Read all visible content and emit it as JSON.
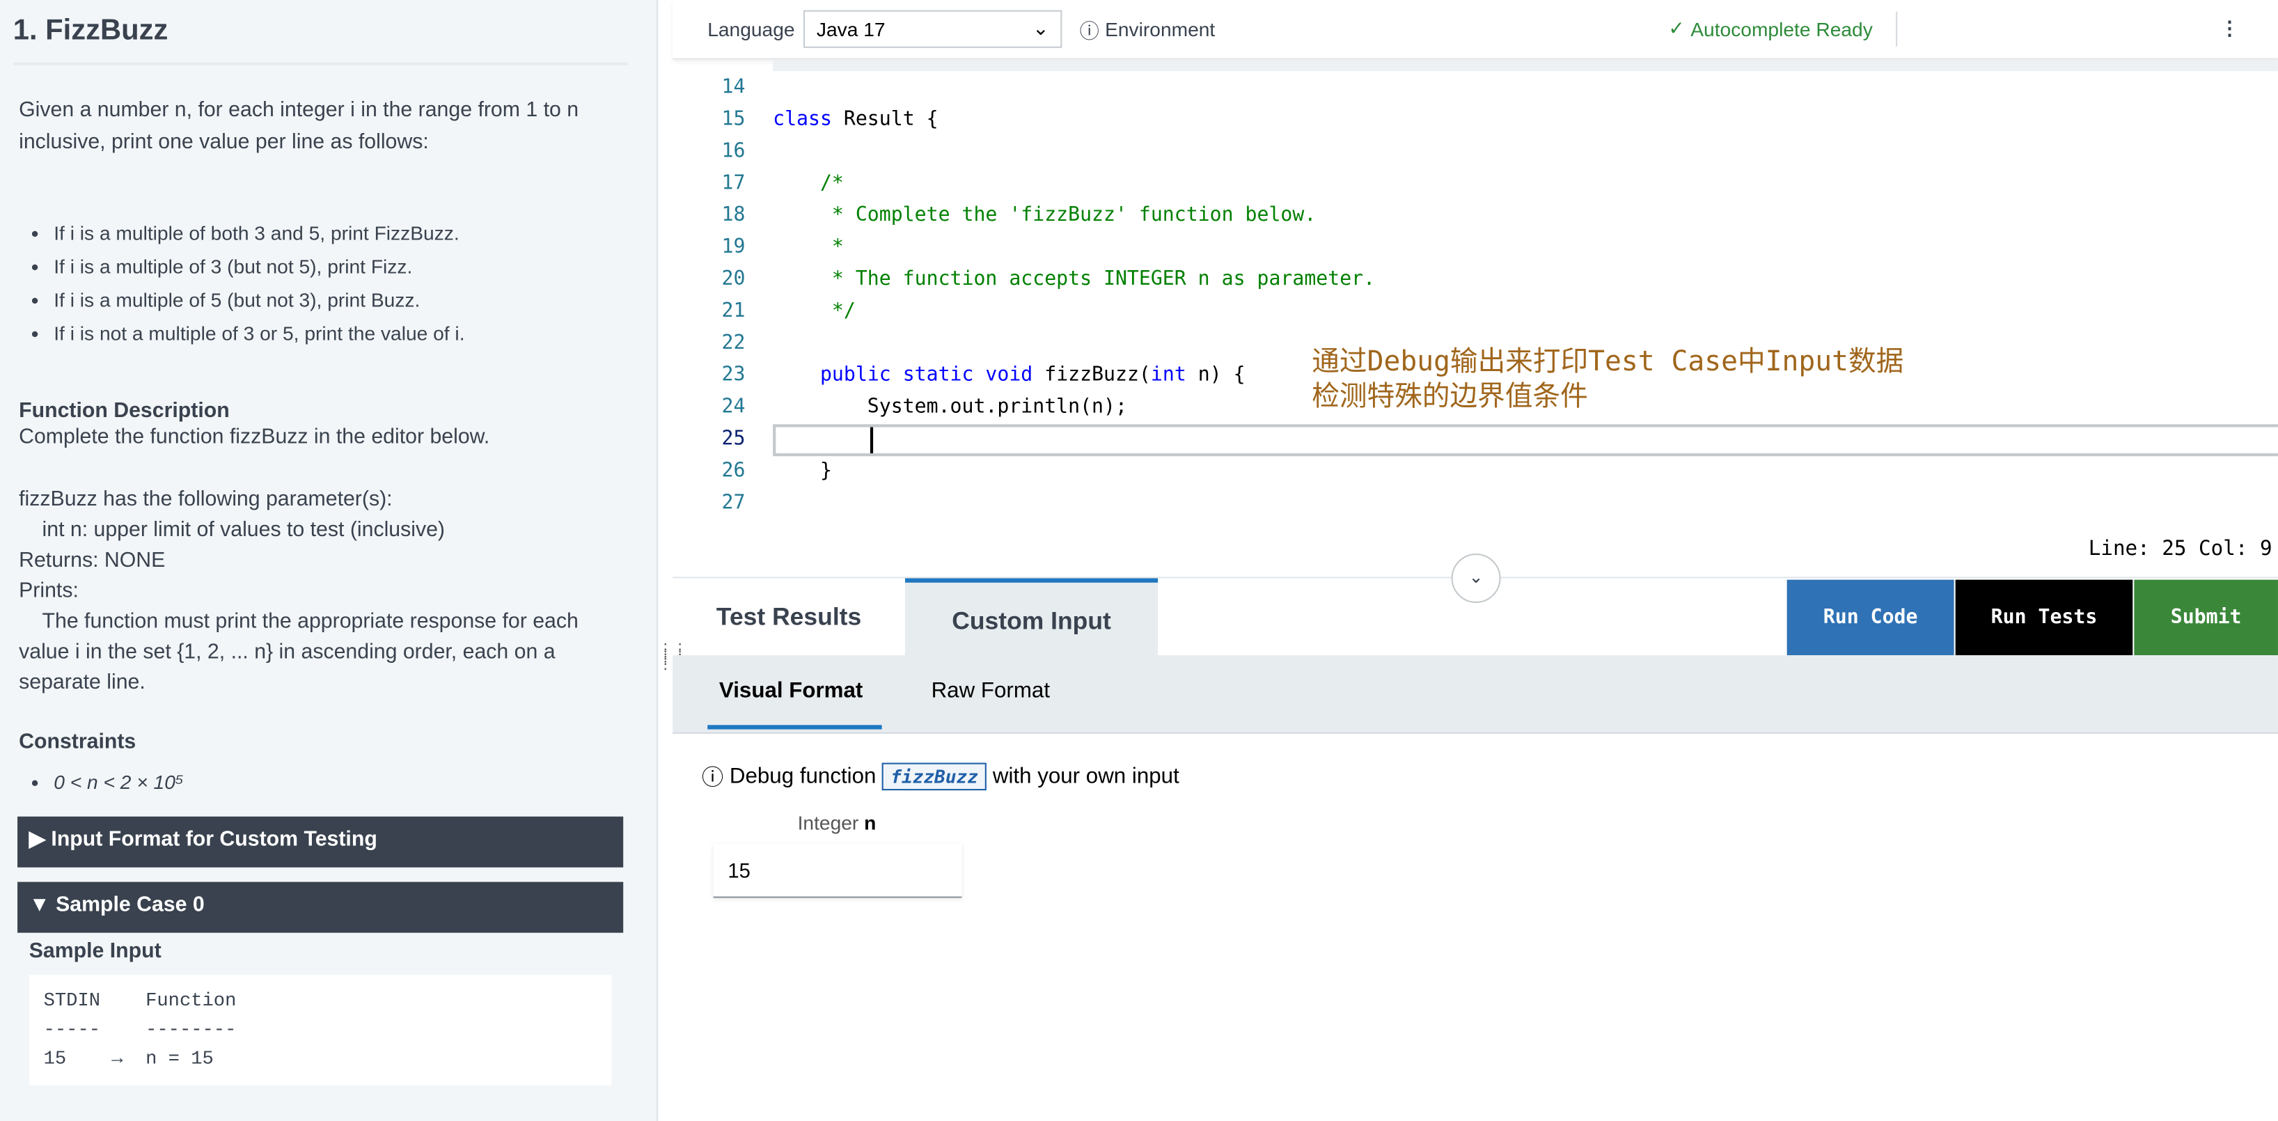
{
  "problem": {
    "title": "1. FizzBuzz",
    "intro": "Given a number n, for each integer i in the range from 1 to n inclusive, print one value per line as follows:",
    "rules": [
      "If i is a multiple of both 3 and 5, print FizzBuzz.",
      "If i is a multiple of 3 (but not 5), print Fizz.",
      "If i is a multiple of 5 (but not 3), print Buzz.",
      "If i is not a multiple of 3 or 5, print the value of i."
    ],
    "func_desc_heading": "Function Description",
    "func_desc": "Complete the function fizzBuzz in the editor below.",
    "params_heading": "fizzBuzz has the following parameter(s):",
    "param": "int n:  upper limit of values to test (inclusive)",
    "returns": "Returns:    NONE",
    "prints_heading": "Prints:",
    "prints": "The function must print the appropriate response for each value i in the set {1, 2, ... n} in ascending order, each on a separate line.",
    "constraints_heading": "Constraints",
    "constraint": "0 < n < 2 × 10⁵",
    "input_format_bar": "▶ Input Format for Custom Testing",
    "sample_bar": "▼ Sample Case 0",
    "sample_input_heading": "Sample Input",
    "sample_code": "STDIN    Function\n-----    --------\n15    →  n = 15"
  },
  "toolbar": {
    "language_label": "Language",
    "language_value": "Java 17",
    "environment": "Environment",
    "autocomplete": "Autocomplete Ready",
    "more": "⋮"
  },
  "editor": {
    "lines": [
      {
        "n": "14",
        "html": ""
      },
      {
        "n": "15",
        "html": "<span class='kw'>class</span> Result {"
      },
      {
        "n": "16",
        "html": ""
      },
      {
        "n": "17",
        "html": "    <span class='cm'>/*</span>"
      },
      {
        "n": "18",
        "html": "<span class='cm'>     * Complete the 'fizzBuzz' function below.</span>"
      },
      {
        "n": "19",
        "html": "<span class='cm'>     *</span>"
      },
      {
        "n": "20",
        "html": "<span class='cm'>     * The function accepts INTEGER n as parameter.</span>"
      },
      {
        "n": "21",
        "html": "<span class='cm'>     */</span>"
      },
      {
        "n": "22",
        "html": ""
      },
      {
        "n": "23",
        "html": "    <span class='kw'>public static void</span> fizzBuzz(<span class='kw'>int</span> n) {"
      },
      {
        "n": "24",
        "html": "        System.out.println(n);"
      },
      {
        "n": "25",
        "html": ""
      },
      {
        "n": "26",
        "html": "    }"
      },
      {
        "n": "27",
        "html": ""
      }
    ],
    "annotation_line1": "通过Debug输出来打印Test Case中Input数据",
    "annotation_line2": "检测特殊的边界值条件",
    "status": "Line: 25 Col: 9"
  },
  "tabs": {
    "test_results": "Test Results",
    "custom_input": "Custom Input",
    "run_code": "Run Code",
    "run_tests": "Run Tests",
    "submit": "Submit",
    "visual_format": "Visual Format",
    "raw_format": "Raw Format"
  },
  "custom": {
    "debug_prefix": "Debug function",
    "fn": "fizzBuzz",
    "debug_suffix": "with your own input",
    "field_label": "Integer",
    "field_var": "n",
    "field_value": "15"
  },
  "colors": {
    "run_code": "#2f72b5",
    "run_tests": "#000000",
    "submit": "#3a873a",
    "annotation": "#a0661c",
    "autocomplete": "#2e8b3a"
  }
}
